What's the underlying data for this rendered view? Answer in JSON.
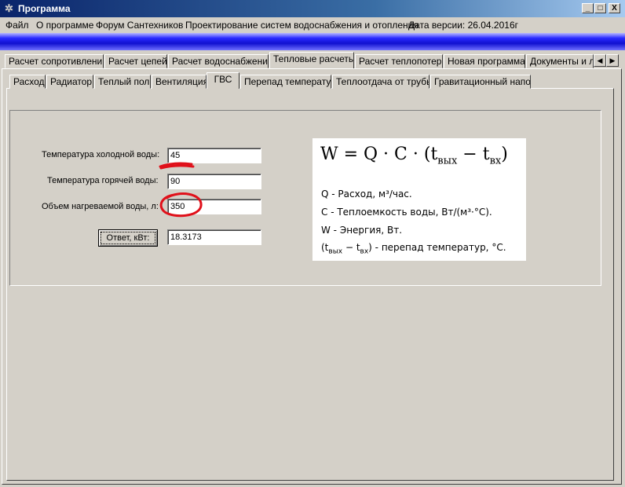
{
  "window": {
    "title": "Программа",
    "icon": "gear-icon",
    "controls": {
      "minimize": "_",
      "maximize": "□",
      "close": "X"
    }
  },
  "menu": [
    "Файл",
    "О программе",
    "Форум Сантехников",
    "Проектирование систем водоснабжения и отопления",
    "Дата версии: 26.04.2016г"
  ],
  "tabs_top": [
    "Расчет сопротивлений",
    "Расчет цепей",
    "Расчет водоснабжения",
    "Тепловые расчеты",
    "Расчет теплопотерь",
    "Новая программа",
    "Документы и л"
  ],
  "tabs_top_active": "Тепловые расчеты",
  "tabs_sub": [
    "Расход",
    "Радиатор",
    "Теплый пол",
    "Вентиляция",
    "ГВС",
    "Перепад температур",
    "Теплоотдача от трубы",
    "Гравитационный напор"
  ],
  "tabs_sub_active": "ГВС",
  "form": {
    "cold_label": "Температура холодной воды:",
    "cold_value": "45",
    "hot_label": "Температура горячей воды:",
    "hot_value": "90",
    "volume_label": "Объем нагреваемой воды, л:",
    "volume_value": "350",
    "answer_button": "Ответ, кВт:",
    "answer_value": "18.3173"
  },
  "formula": {
    "main_prefix": "W = Q · C · (t",
    "sub_out": "вых",
    "minus": " − t",
    "sub_in": "вх",
    "close": ")",
    "line1": "Q - Расход, м³/час.",
    "line2": "C - Теплоемкость воды, Вт/(м³·°С).",
    "line3": "W - Энергия, Вт.",
    "line4_open": "(t",
    "line4_sub_out": "вых",
    "line4_minus": " − t",
    "line4_sub_in": "вх",
    "line4_rest": ") - перепад температур, °С."
  },
  "colors": {
    "annotation": "#e0101a",
    "window_bg": "#d4d0c8",
    "title_bar": "#0a246a"
  }
}
